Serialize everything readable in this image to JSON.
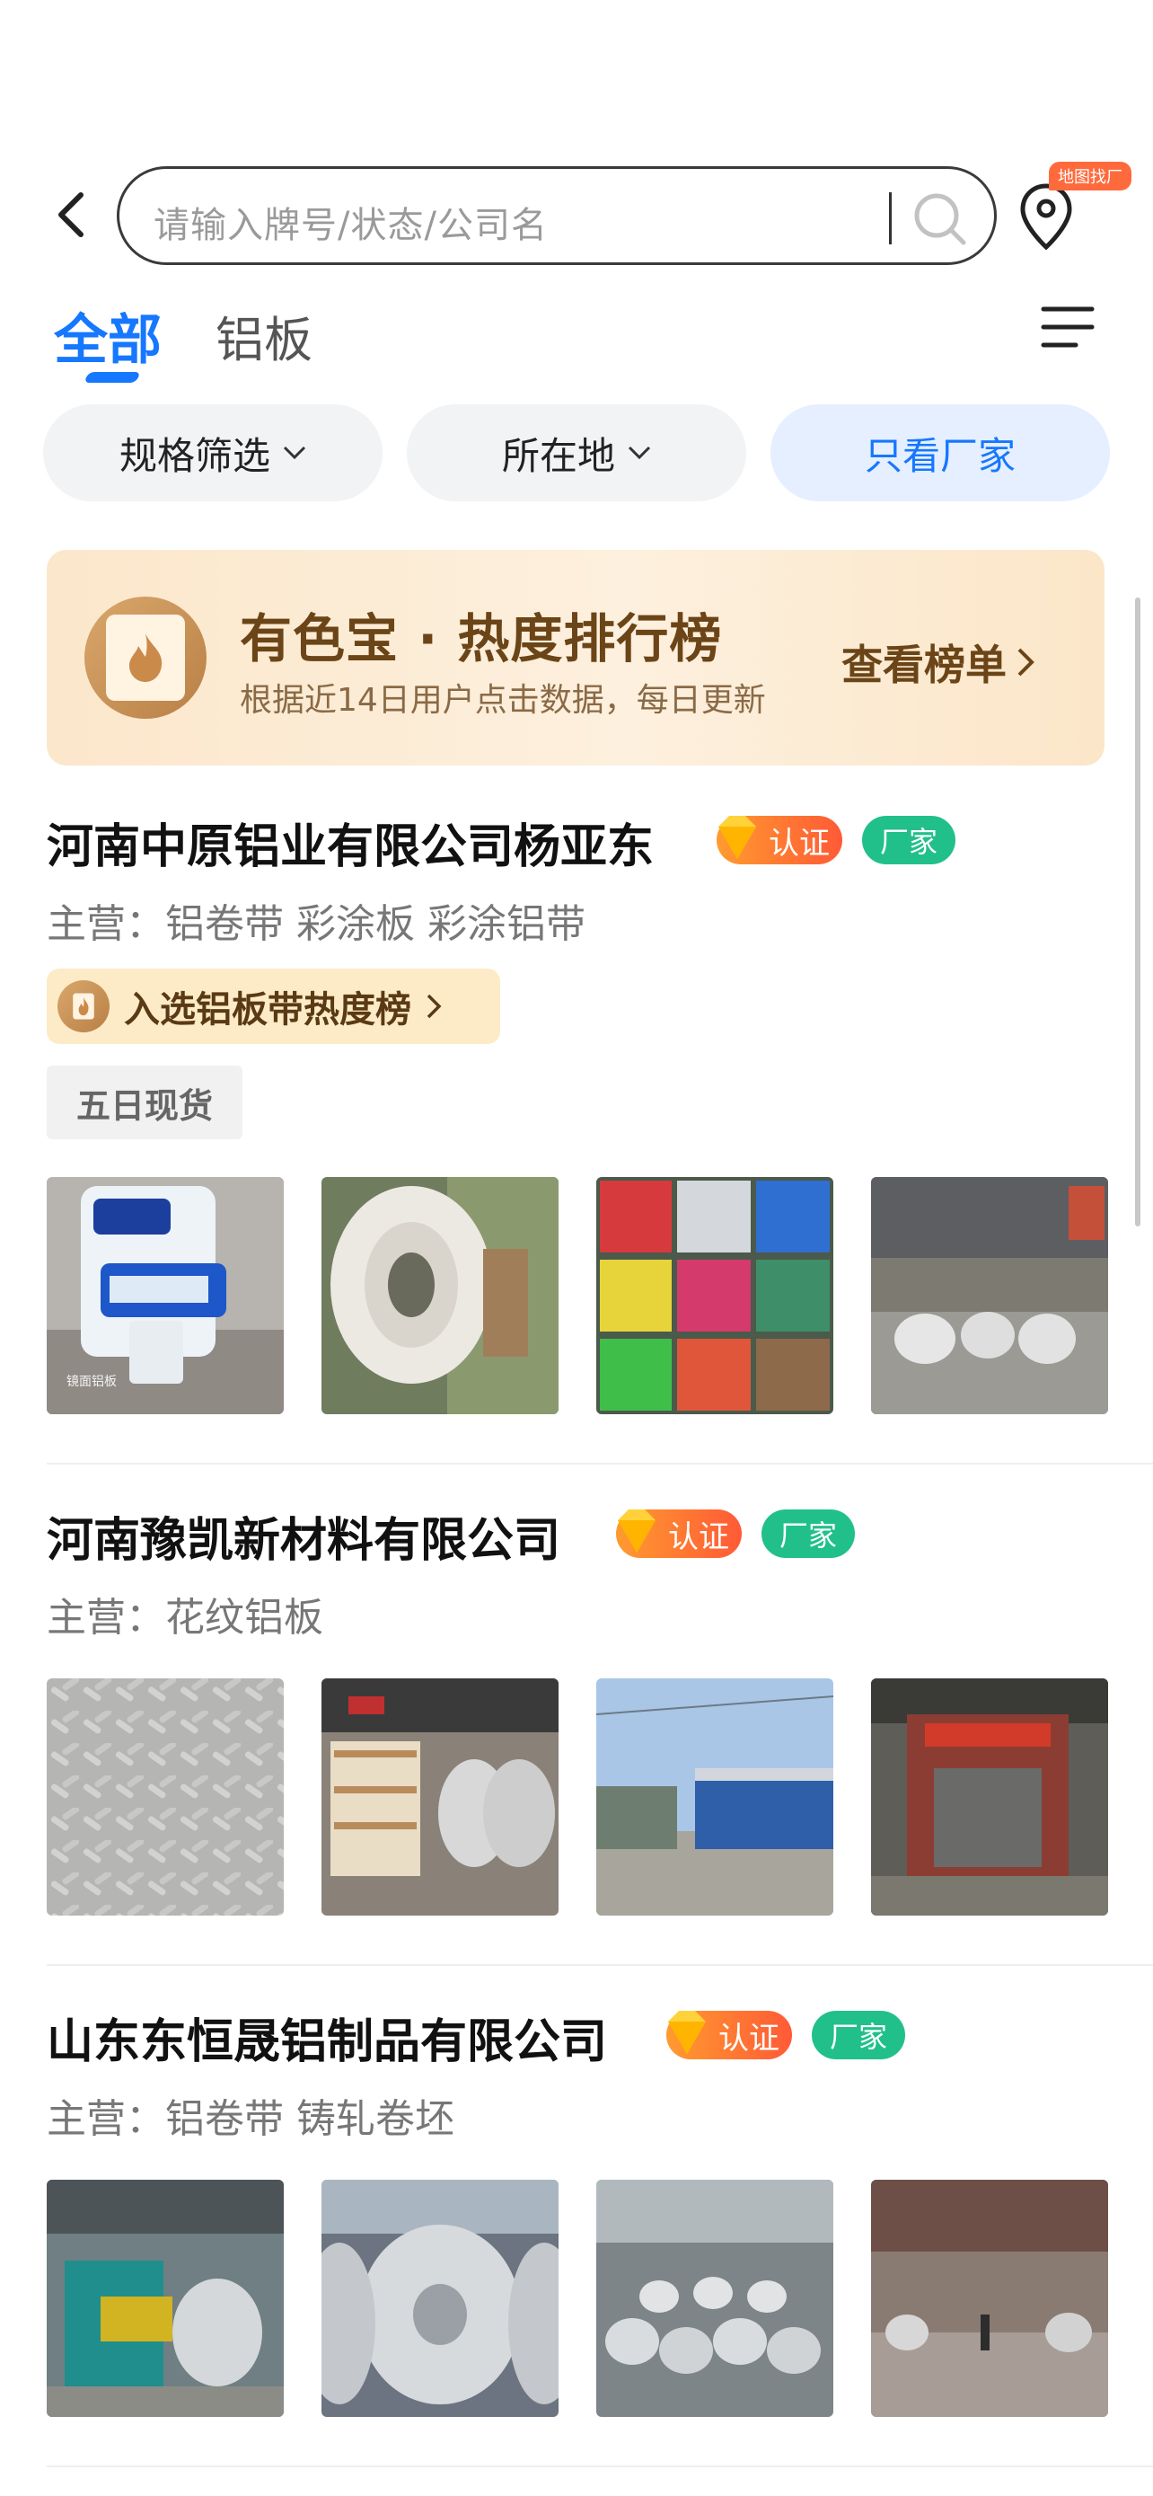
{
  "header": {
    "search_placeholder": "请输入牌号/状态/公司名",
    "map_badge": "地图找厂"
  },
  "tabs": [
    {
      "label": "全部",
      "active": true
    },
    {
      "label": "铝板",
      "active": false
    }
  ],
  "filters": [
    {
      "label": "规格筛选"
    },
    {
      "label": "所在地"
    },
    {
      "label": "只看厂家"
    }
  ],
  "banner": {
    "title": "有色宝 · 热度排行榜",
    "subtitle": "根据近14日用户点击数据，每日更新",
    "link": "查看榜单"
  },
  "companies": [
    {
      "name": "河南中原铝业有限公司杨亚东",
      "cert": "认证",
      "type": "厂家",
      "main": "主营：铝卷带  彩涂板  彩涂铝带",
      "hot_tag": "入选铝板带热度榜",
      "stock_tag": "五日现货",
      "photo_captions": [
        "镜面铝板"
      ]
    },
    {
      "name": "河南豫凯新材料有限公司",
      "cert": "认证",
      "type": "厂家",
      "main": "主营：花纹铝板"
    },
    {
      "name": "山东东恒晟铝制品有限公司",
      "cert": "认证",
      "type": "厂家",
      "main": "主营：铝卷带  铸轧卷坯"
    }
  ],
  "colors": {
    "accent": "#1677ff",
    "factory": "#21c08b",
    "cert_start": "#ff9b2f",
    "cert_end": "#ff5a36"
  }
}
